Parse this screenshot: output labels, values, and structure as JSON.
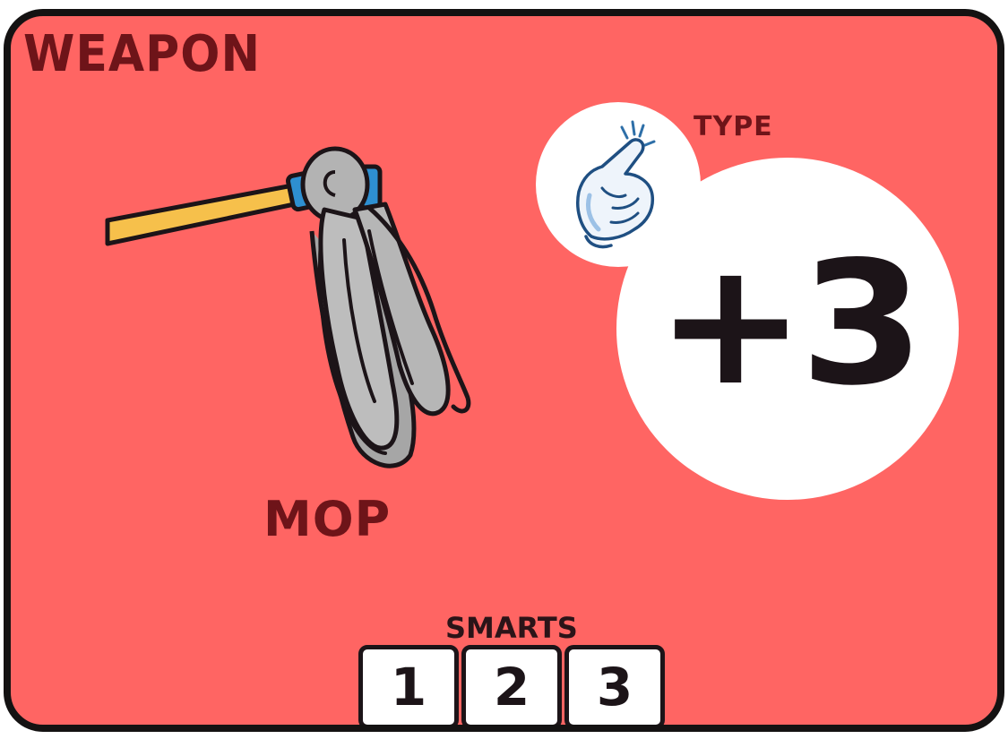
{
  "card": {
    "category": "WEAPON",
    "item_name": "MOP",
    "bonus": "+3",
    "type_label": "TYPE",
    "type_icon": "finger-snap-hand-icon",
    "item_icon": "mop-icon",
    "stat_label": "SMARTS",
    "stat_values": [
      "1",
      "2",
      "3"
    ]
  },
  "colors": {
    "background": "#ff6563",
    "border": "#141212",
    "label_text": "#6e1419",
    "circle": "#ffffff",
    "number_text": "#1c1418"
  }
}
